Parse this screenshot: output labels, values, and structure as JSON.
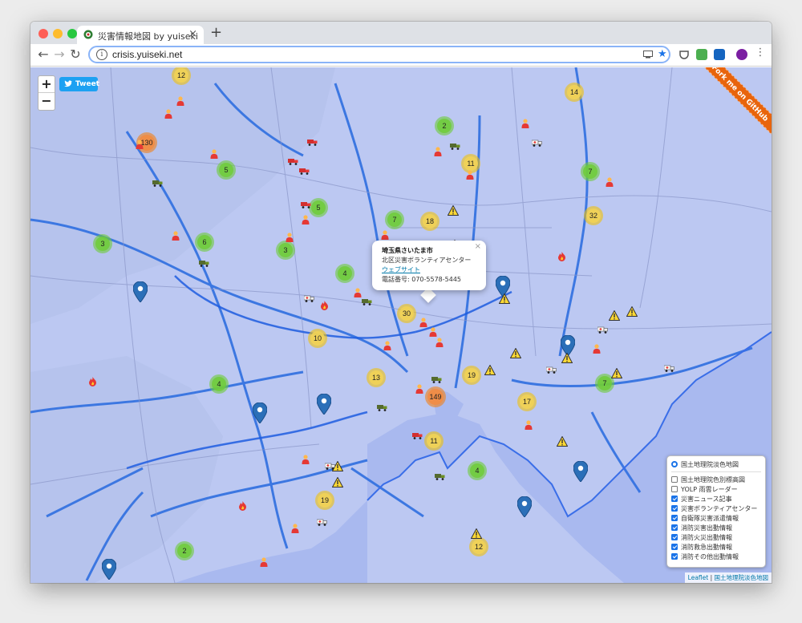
{
  "browser": {
    "tab_title": "災害情報地図 by yuiseki",
    "tab_close": "×",
    "new_tab": "+",
    "url": "crisis.yuiseki.net"
  },
  "map": {
    "zoom_in": "+",
    "zoom_out": "−",
    "tweet_label": "Tweet",
    "ribbon_text": "Fork me on GitHub",
    "clusters": [
      "12",
      "14",
      "130",
      "2",
      "11",
      "5",
      "7",
      "5",
      "7",
      "18",
      "32",
      "3",
      "6",
      "3",
      "4",
      "30",
      "10",
      "13",
      "19",
      "4",
      "149",
      "17",
      "7",
      "11",
      "4",
      "19",
      "12",
      "2"
    ],
    "popup": {
      "title": "埼玉県さいたま市",
      "name": "北区災害ボランティアセンター",
      "link": "ウェブサイト",
      "phone": "電話番号: 070-5578-5445",
      "close": "×"
    },
    "layers": {
      "base_selected": "国土地理院淡色地図",
      "base_other": "国土地理院色別標高図",
      "overlay_other": "YOLP 雨雲レーダー",
      "overlays": [
        "災害ニュース記事",
        "災害ボランティアセンター",
        "自衛隊災害派遣情報",
        "消防災害出動情報",
        "消防火災出動情報",
        "消防救急出動情報",
        "消防その他出動情報"
      ]
    },
    "attribution": {
      "leaflet": "Leaflet",
      "sep": " | ",
      "tiles": "国土地理院淡色地図"
    }
  }
}
